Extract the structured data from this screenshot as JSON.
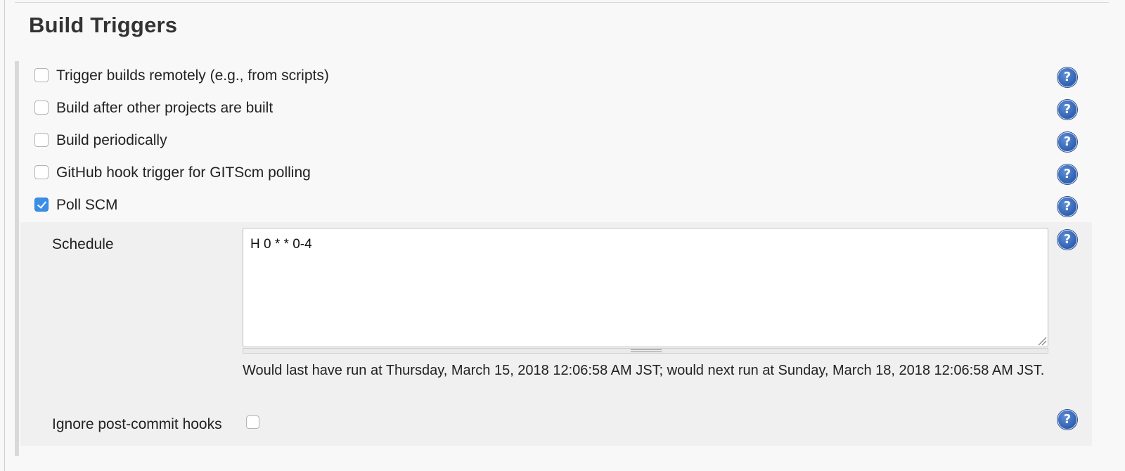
{
  "section": {
    "title": "Build Triggers"
  },
  "triggers": [
    {
      "label": "Trigger builds remotely (e.g., from scripts)",
      "checked": false
    },
    {
      "label": "Build after other projects are built",
      "checked": false
    },
    {
      "label": "Build periodically",
      "checked": false
    },
    {
      "label": "GitHub hook trigger for GITScm polling",
      "checked": false
    },
    {
      "label": "Poll SCM",
      "checked": true
    }
  ],
  "poll_scm": {
    "schedule_label": "Schedule",
    "schedule_value": "H 0 * * 0-4",
    "schedule_info": "Would last have run at Thursday, March 15, 2018 12:06:58 AM JST; would next run at Sunday, March 18, 2018 12:06:58 AM JST.",
    "ignore_hooks_label": "Ignore post-commit hooks",
    "ignore_hooks_checked": false
  },
  "help": {
    "glyph": "?",
    "icon": "help-icon",
    "color": "#2f5fb0"
  },
  "colors": {
    "checkbox_checked": "#3b8ee8",
    "background": "#f8f8f8",
    "sub_background": "#f0f0f0"
  }
}
